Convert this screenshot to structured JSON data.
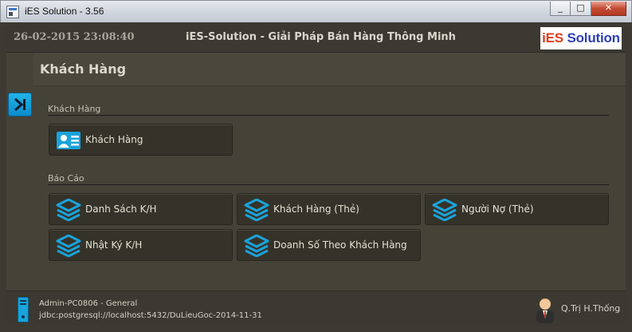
{
  "window": {
    "title": "iES Solution - 3.56",
    "controls": [
      "_",
      "□",
      "✕"
    ]
  },
  "header": {
    "datetime": "26-02-2015 23:08:40",
    "title": "iES-Solution - Giải Pháp Bán Hàng Thông Minh",
    "logo_part1": "iES",
    "logo_part2": "Solution"
  },
  "page": {
    "title": "Khách Hàng"
  },
  "groups": [
    {
      "label": "Khách Hàng",
      "tiles": [
        {
          "label": "Khách Hàng",
          "icon": "customer-card-icon"
        }
      ]
    },
    {
      "label": "Báo Cáo",
      "tiles": [
        {
          "label": "Danh Sách K/H",
          "icon": "layers-icon"
        },
        {
          "label": "Khách Hàng (Thẻ)",
          "icon": "layers-icon"
        },
        {
          "label": "Người Nợ (Thẻ)",
          "icon": "layers-icon"
        },
        {
          "label": "Nhật Ký K/H",
          "icon": "layers-icon"
        },
        {
          "label": "Doanh Số Theo Khách Hàng",
          "icon": "layers-icon"
        }
      ]
    }
  ],
  "status": {
    "computer": "Admin-PC0806 - General",
    "connection": "jdbc:postgresql://localhost:5432/DuLieuGoc-2014-11-31",
    "user": "Q.Trị H.Thống"
  },
  "colors": {
    "accent": "#1aa3dc",
    "background": "#454238",
    "tile": "#353329"
  }
}
